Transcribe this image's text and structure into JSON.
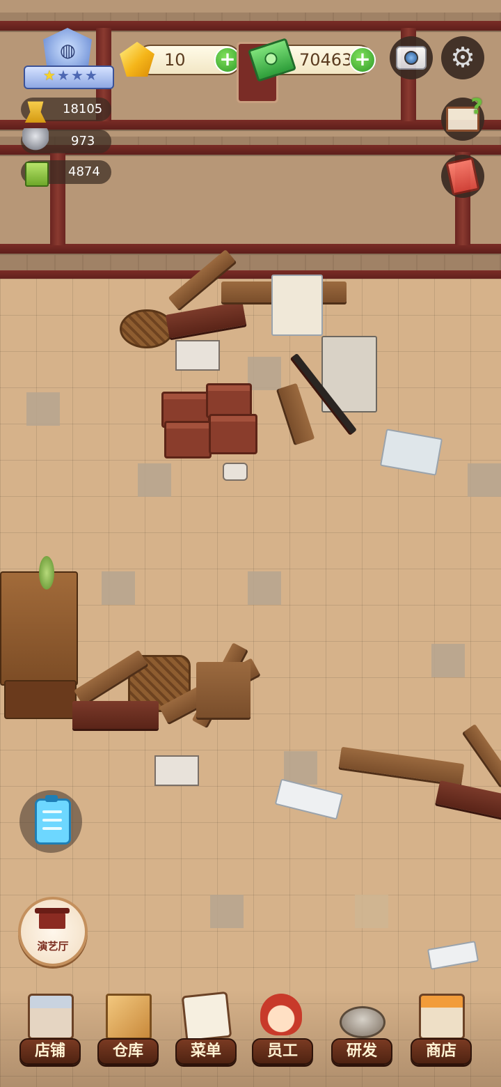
{
  "hud": {
    "player_rank": {
      "stars_filled": 1,
      "stars_total": 4
    },
    "gems": {
      "value": "10"
    },
    "cash": {
      "value": "70463"
    },
    "resources": [
      {
        "name": "tip-trophy",
        "value": "18105"
      },
      {
        "name": "dish-cover",
        "value": "973"
      },
      {
        "name": "recipe-book",
        "value": "4874"
      }
    ]
  },
  "left_buttons": {
    "theater_label": "演艺厅"
  },
  "bottom_nav": [
    {
      "id": "shop",
      "label": "店铺"
    },
    {
      "id": "warehouse",
      "label": "仓库"
    },
    {
      "id": "menu",
      "label": "菜单"
    },
    {
      "id": "staff",
      "label": "员工"
    },
    {
      "id": "research",
      "label": "研发"
    },
    {
      "id": "store",
      "label": "商店"
    }
  ],
  "colors": {
    "accent_green": "#2f9a2a",
    "gold": "#f5b61a",
    "nav_label_bg": "#7a3a22",
    "wall_wood": "#7a2c26"
  }
}
